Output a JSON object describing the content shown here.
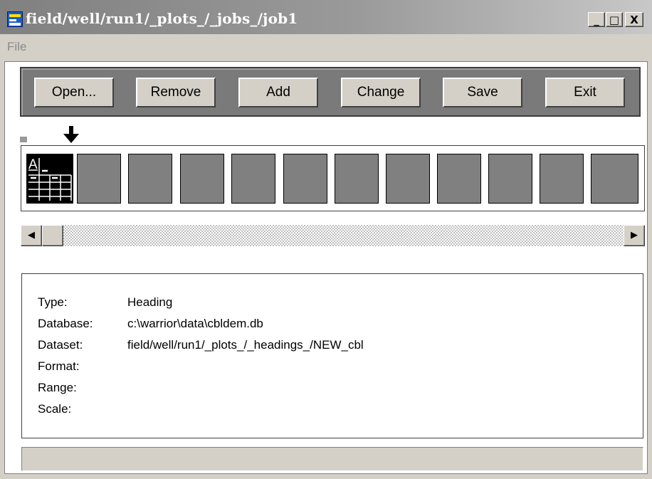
{
  "window": {
    "title": "field/well/run1/_plots_/_jobs_/job1",
    "controls": {
      "minimize": "_",
      "maximize": "□",
      "close": "X"
    }
  },
  "menu": {
    "items": [
      "File"
    ]
  },
  "toolbar": {
    "buttons": [
      "Open...",
      "Remove",
      "Add",
      "Change",
      "Save",
      "Exit"
    ]
  },
  "strip": {
    "selected_icon": "heading-table-icon",
    "selected_icon_text": "A",
    "pointer_icon": "down-arrow-icon",
    "empty_slots": 11
  },
  "scrollbar": {
    "left_arrow": "◀",
    "right_arrow": "▶"
  },
  "details": {
    "rows": [
      {
        "label": "Type:",
        "value": "Heading"
      },
      {
        "label": "Database:",
        "value": "c:\\warrior\\data\\cbldem.db"
      },
      {
        "label": "Dataset:",
        "value": "field/well/run1/_plots_/_headings_/NEW_cbl"
      },
      {
        "label": "Format:",
        "value": ""
      },
      {
        "label": "Range:",
        "value": ""
      },
      {
        "label": "Scale:",
        "value": ""
      }
    ]
  },
  "status": {
    "text": ""
  },
  "colors": {
    "face": "#d4d0c8",
    "toolbar_bg": "#7a7a7a",
    "slot": "#808080",
    "title_text": "#ffffff",
    "menu_disabled": "#8a8a8a"
  }
}
